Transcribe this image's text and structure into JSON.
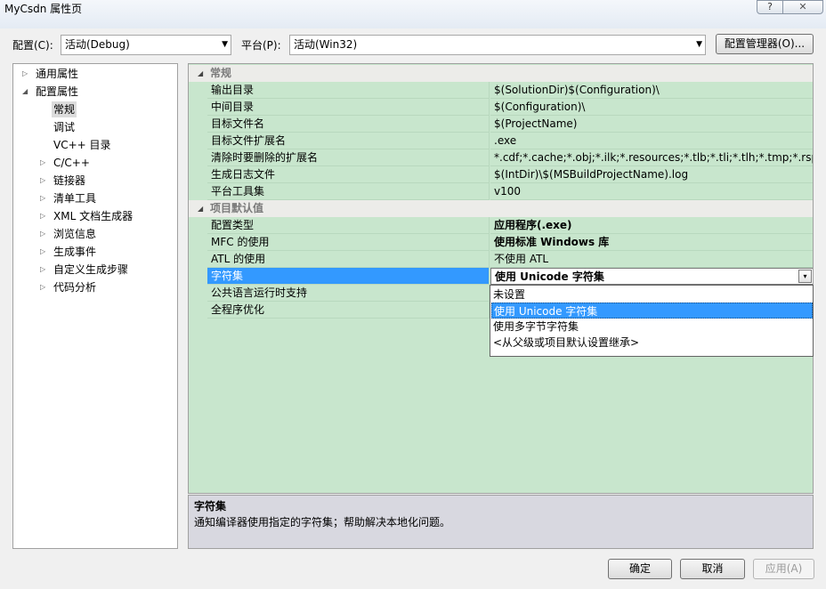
{
  "window": {
    "title": "MyCsdn 属性页",
    "help_glyph": "?",
    "close_glyph": "✕"
  },
  "top": {
    "config_label": "配置(C):",
    "config_value": "活动(Debug)",
    "platform_label": "平台(P):",
    "platform_value": "活动(Win32)",
    "manager_button": "配置管理器(O)..."
  },
  "tree": {
    "nodes": [
      {
        "label": "通用属性",
        "glyph": "▷"
      },
      {
        "label": "配置属性",
        "glyph": "◢"
      },
      {
        "label": "常规"
      },
      {
        "label": "调试"
      },
      {
        "label": "VC++ 目录"
      },
      {
        "label": "C/C++",
        "glyph": "▷"
      },
      {
        "label": "链接器",
        "glyph": "▷"
      },
      {
        "label": "清单工具",
        "glyph": "▷"
      },
      {
        "label": "XML 文档生成器",
        "glyph": "▷"
      },
      {
        "label": "浏览信息",
        "glyph": "▷"
      },
      {
        "label": "生成事件",
        "glyph": "▷"
      },
      {
        "label": "自定义生成步骤",
        "glyph": "▷"
      },
      {
        "label": "代码分析",
        "glyph": "▷"
      }
    ]
  },
  "grid": {
    "cat_glyph": "◢",
    "dropdown_glyph": "▾",
    "categories": [
      {
        "name": "常规",
        "rows": [
          {
            "name": "输出目录",
            "value": "$(SolutionDir)$(Configuration)\\"
          },
          {
            "name": "中间目录",
            "value": "$(Configuration)\\"
          },
          {
            "name": "目标文件名",
            "value": "$(ProjectName)"
          },
          {
            "name": "目标文件扩展名",
            "value": ".exe"
          },
          {
            "name": "清除时要删除的扩展名",
            "value": "*.cdf;*.cache;*.obj;*.ilk;*.resources;*.tlb;*.tli;*.tlh;*.tmp;*.rsp;*.pgc"
          },
          {
            "name": "生成日志文件",
            "value": "$(IntDir)\\$(MSBuildProjectName).log"
          },
          {
            "name": "平台工具集",
            "value": "v100"
          }
        ]
      },
      {
        "name": "项目默认值",
        "rows": [
          {
            "name": "配置类型",
            "value": "应用程序(.exe)"
          },
          {
            "name": "MFC 的使用",
            "value": "使用标准 Windows 库"
          },
          {
            "name": "ATL 的使用",
            "value": "不使用 ATL"
          },
          {
            "name": "字符集",
            "value": "使用 Unicode 字符集"
          },
          {
            "name": "公共语言运行时支持",
            "value": ""
          },
          {
            "name": "全程序优化",
            "value": ""
          }
        ]
      }
    ],
    "dropdown_options": [
      "未设置",
      "使用 Unicode 字符集",
      "使用多字节字符集",
      "<从父级或项目默认设置继承>"
    ]
  },
  "description": {
    "title": "字符集",
    "text": "通知编译器使用指定的字符集；帮助解决本地化问题。"
  },
  "buttons": {
    "ok": "确定",
    "cancel": "取消",
    "apply": "应用(A)"
  }
}
